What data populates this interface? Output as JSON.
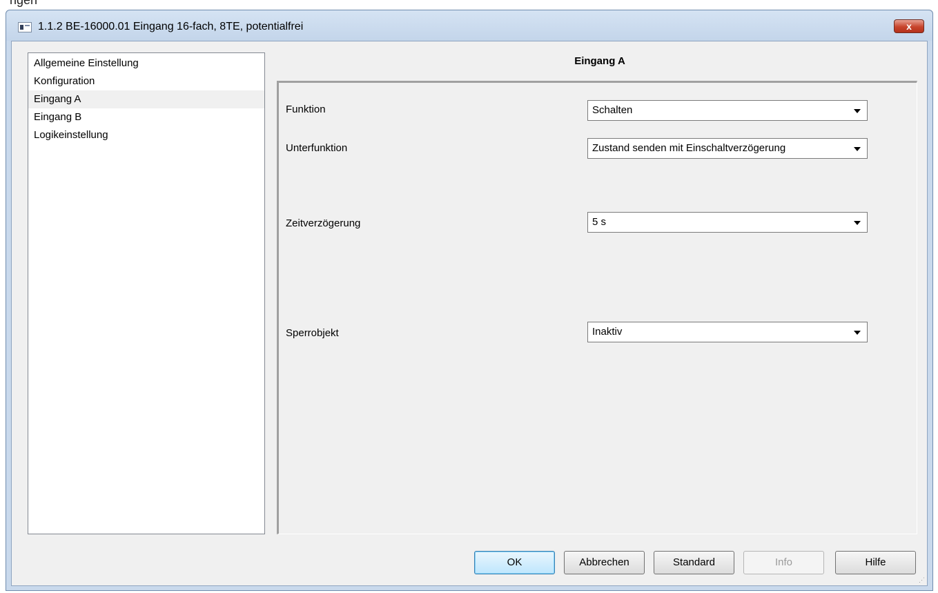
{
  "background": {
    "partial_text": "ngen"
  },
  "window": {
    "title": "1.1.2 BE-16000.01 Eingang 16-fach, 8TE, potentialfrei",
    "close_label": "x"
  },
  "tree": {
    "items": [
      {
        "label": "Allgemeine Einstellung"
      },
      {
        "label": "Konfiguration"
      },
      {
        "label": "Eingang A"
      },
      {
        "label": "Eingang B"
      },
      {
        "label": "Logikeinstellung"
      }
    ],
    "selected": "Eingang A"
  },
  "panel": {
    "title": "Eingang A",
    "fields": [
      {
        "label": "Funktion",
        "value": "Schalten"
      },
      {
        "label": "Unterfunktion",
        "value": "Zustand senden mit Einschaltverzögerung"
      },
      {
        "label": "Zeitverzögerung",
        "value": "5 s"
      },
      {
        "label": "Sperrobjekt",
        "value": "Inaktiv"
      }
    ]
  },
  "buttons": {
    "ok": "OK",
    "cancel": "Abbrechen",
    "standard": "Standard",
    "info": "Info",
    "help": "Hilfe"
  },
  "colors": {
    "window_frame": "#c9d9ec",
    "close_button": "#c7442c",
    "default_button": "#bee6fd"
  }
}
